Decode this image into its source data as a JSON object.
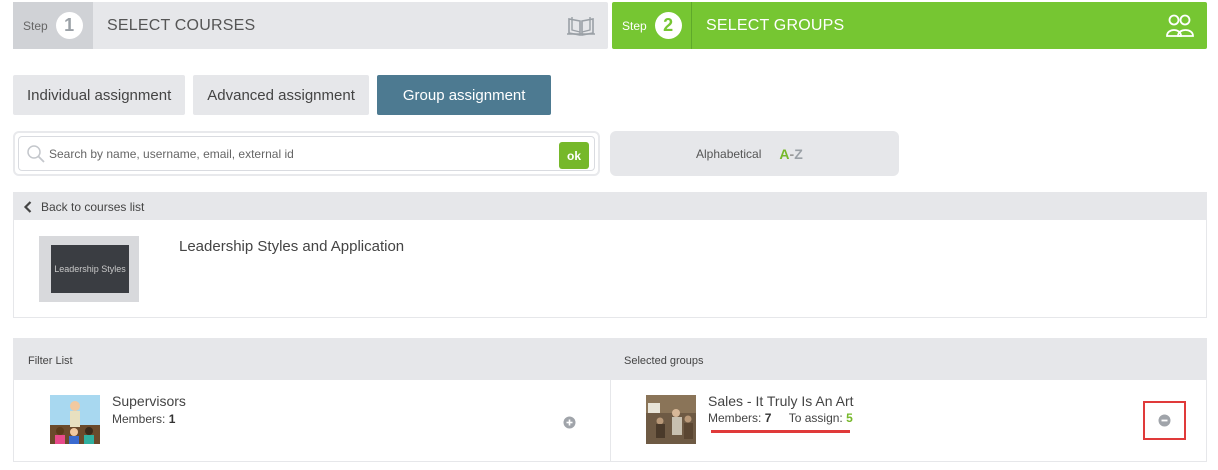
{
  "steps": [
    {
      "tag": "Step",
      "number": "1",
      "title": "SELECT COURSES",
      "icon": "open-book-icon"
    },
    {
      "tag": "Step",
      "number": "2",
      "title": "SELECT GROUPS",
      "icon": "users-group-icon"
    }
  ],
  "tabs": [
    {
      "label": "Individual assignment",
      "active": false
    },
    {
      "label": "Advanced assignment",
      "active": false
    },
    {
      "label": "Group assignment",
      "active": true
    }
  ],
  "search": {
    "placeholder": "Search by name, username, email, external id",
    "value": "",
    "ok_label": "ok"
  },
  "sort": {
    "label": "Alphabetical",
    "az_a": "A",
    "az_dash": "-",
    "az_z": "Z"
  },
  "course": {
    "back_label": "Back to courses list",
    "title": "Leadership Styles and Application",
    "thumb_text": "Leadership Styles"
  },
  "groups": {
    "filter_header": "Filter List",
    "selected_header": "Selected groups",
    "available": [
      {
        "name": "Supervisors",
        "members_label": "Members:",
        "members": "1"
      }
    ],
    "selected": [
      {
        "name": "Sales - It Truly Is An Art",
        "members_label": "Members:",
        "members": "7",
        "assign_label": "To assign:",
        "to_assign": "5"
      }
    ]
  },
  "colors": {
    "accent_green": "#76c632",
    "active_tab": "#4d7a91",
    "highlight_red": "#e03a3a"
  }
}
